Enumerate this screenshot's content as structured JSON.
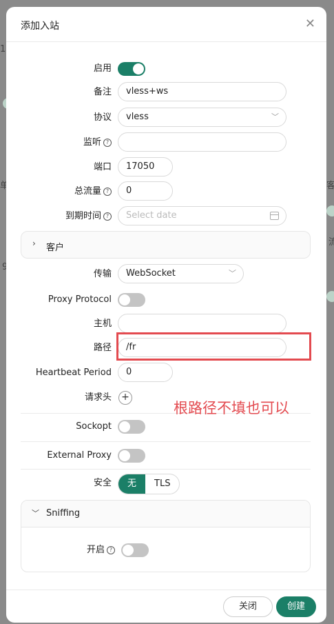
{
  "background": {
    "fragments": [
      "1.",
      "单",
      "客",
      "流",
      "9"
    ]
  },
  "modal": {
    "title": "添加入站",
    "close_icon": "close-icon",
    "fields": {
      "enable_label": "启用",
      "enable": true,
      "remark_label": "备注",
      "remark_value": "vless+ws",
      "protocol_label": "协议",
      "protocol_value": "vless",
      "listen_label": "监听",
      "listen_value": "",
      "port_label": "端口",
      "port_value": "17050",
      "total_traffic_label": "总流量",
      "total_traffic_value": "0",
      "expiry_label": "到期时间",
      "expiry_placeholder": "Select date"
    },
    "clients_section": {
      "label": "客户",
      "expanded": false
    },
    "transport": {
      "label": "传输",
      "value": "WebSocket",
      "proxy_protocol_label": "Proxy Protocol",
      "proxy_protocol": false,
      "host_label": "主机",
      "host_value": "",
      "path_label": "路径",
      "path_value": "/fr",
      "heartbeat_label": "Heartbeat Period",
      "heartbeat_value": "0",
      "headers_label": "请求头"
    },
    "sockopt_label": "Sockopt",
    "sockopt": false,
    "external_proxy_label": "External Proxy",
    "external_proxy": false,
    "security": {
      "label": "安全",
      "options": [
        "无",
        "TLS"
      ],
      "selected": "无"
    },
    "sniffing": {
      "title": "Sniffing",
      "enabled_label": "开启",
      "enabled": false
    },
    "footer": {
      "close_label": "关闭",
      "create_label": "创建"
    }
  },
  "annotation": {
    "text": "根路径不填也可以",
    "color": "#e34a4f"
  },
  "colors": {
    "accent": "#1b7f67",
    "toggle_off": "#c4c4c4"
  }
}
